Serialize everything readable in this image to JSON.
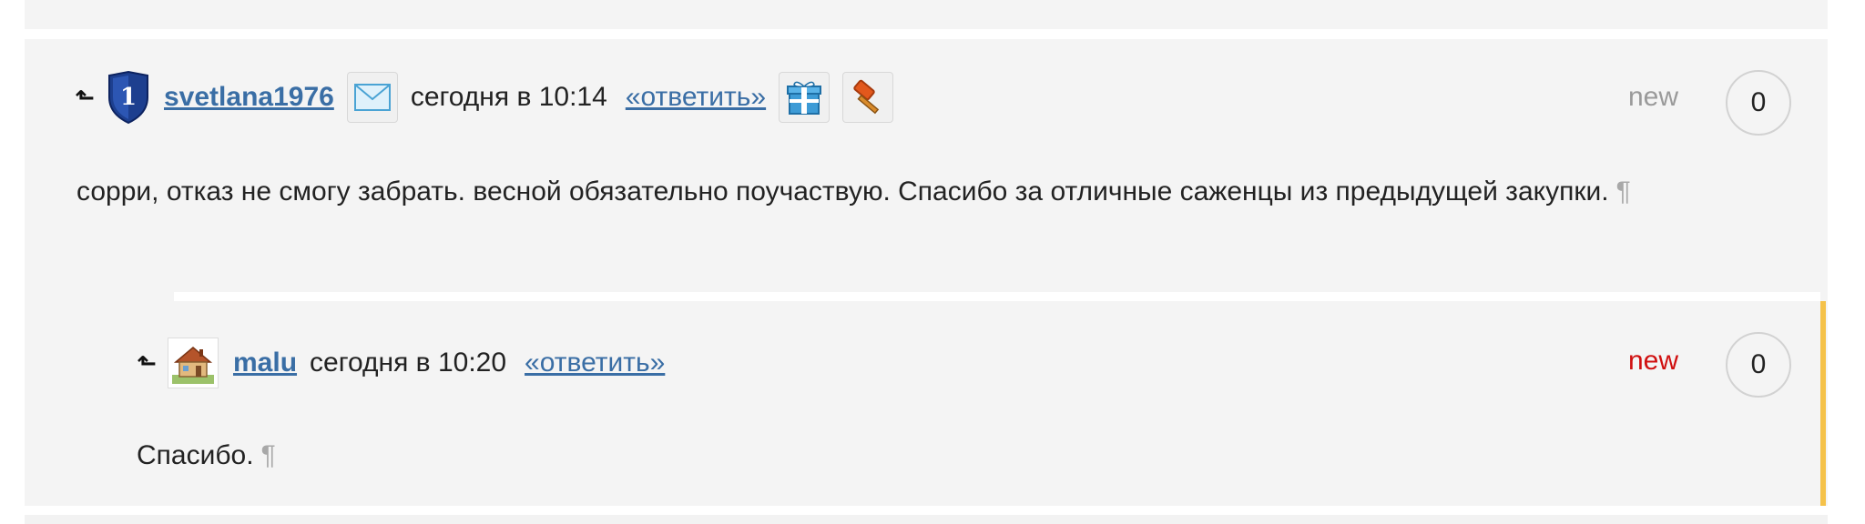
{
  "comments": [
    {
      "username": "svetlana1976",
      "timestamp": "сегодня в 10:14",
      "reply_label": "«ответить»",
      "new_label": "new",
      "count": "0",
      "text": "сорри, отказ не смогу забрать. весной обязательно поучаствую. Спасибо за отличные саженцы из предыдущей закупки.",
      "badge_number": "1",
      "icons": [
        "mail-icon",
        "gift-icon",
        "hammer-icon"
      ]
    },
    {
      "username": "malu",
      "timestamp": "сегодня в 10:20",
      "reply_label": "«ответить»",
      "new_label": "new",
      "count": "0",
      "text": "Спасибо.",
      "icons": [
        "house-avatar-icon"
      ]
    }
  ],
  "pilcrow": "¶",
  "up_arrow": "⬑",
  "colors": {
    "link": "#3a6ea5",
    "new_read": "#9a9a9a",
    "new_unread": "#d01010",
    "accent": "#f5c24a",
    "background": "#f4f4f4"
  }
}
